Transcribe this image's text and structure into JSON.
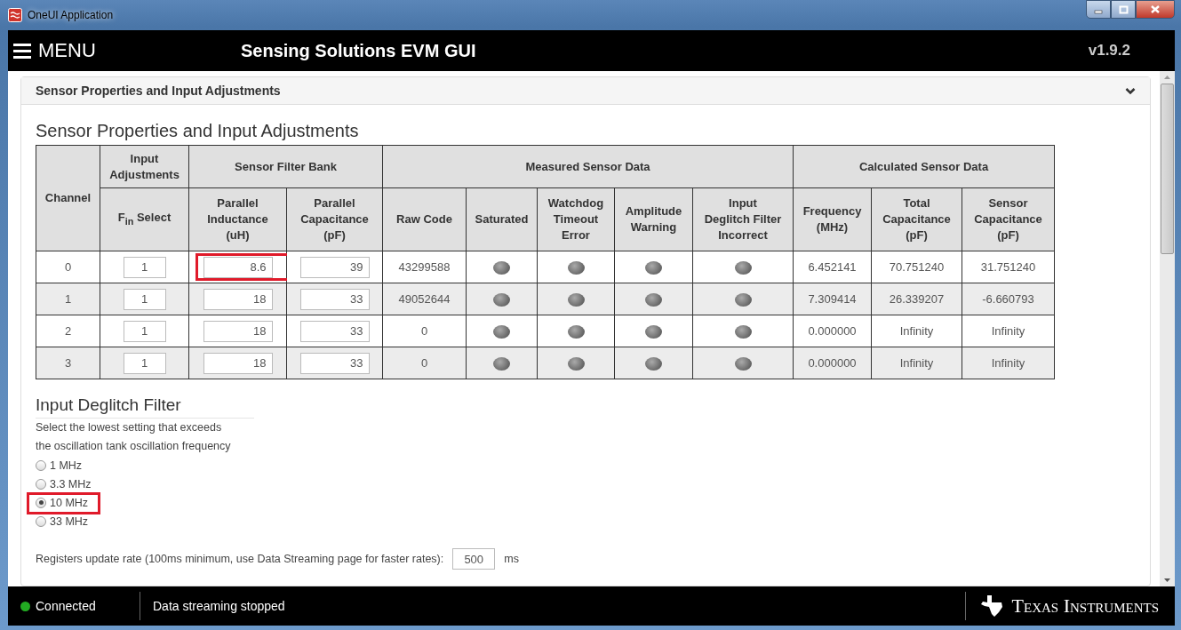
{
  "window": {
    "title": "OneUI Application"
  },
  "header": {
    "menu_label": "MENU",
    "title": "Sensing Solutions EVM GUI",
    "version": "v1.9.2"
  },
  "accordion": {
    "title": "Sensor Properties and Input Adjustments",
    "expanded": true
  },
  "section_title": "Sensor Properties and Input Adjustments",
  "table": {
    "groups": [
      {
        "label": "Channel"
      },
      {
        "label": "Input\nAdjustments",
        "columns": [
          "F$_{in}$ Select"
        ]
      },
      {
        "label": "Sensor Filter Bank",
        "columns": [
          "Parallel\nInductance\n(uH)",
          "Parallel\nCapacitance\n(pF)"
        ]
      },
      {
        "label": "Measured Sensor Data",
        "columns": [
          "Raw Code",
          "Saturated",
          "Watchdog\nTimeout\nError",
          "Amplitude\nWarning",
          "Input\nDeglitch Filter\nIncorrect"
        ]
      },
      {
        "label": "Calculated Sensor Data",
        "columns": [
          "Frequency\n(MHz)",
          "Total\nCapacitance\n(pF)",
          "Sensor\nCapacitance\n(pF)"
        ]
      }
    ],
    "rows": [
      {
        "channel": "0",
        "fin": "1",
        "inductance": "8.6",
        "capacitance": "39",
        "highlighted": true,
        "raw_code": "43299588",
        "saturated": false,
        "watchdog": false,
        "amplitude": false,
        "deglitch": false,
        "frequency": "6.452141",
        "total_capacitance": "70.751240",
        "sensor_capacitance": "31.751240"
      },
      {
        "channel": "1",
        "fin": "1",
        "inductance": "18",
        "capacitance": "33",
        "highlighted": false,
        "raw_code": "49052644",
        "saturated": false,
        "watchdog": false,
        "amplitude": false,
        "deglitch": false,
        "frequency": "7.309414",
        "total_capacitance": "26.339207",
        "sensor_capacitance": "-6.660793"
      },
      {
        "channel": "2",
        "fin": "1",
        "inductance": "18",
        "capacitance": "33",
        "highlighted": false,
        "raw_code": "0",
        "saturated": false,
        "watchdog": false,
        "amplitude": false,
        "deglitch": false,
        "frequency": "0.000000",
        "total_capacitance": "Infinity",
        "sensor_capacitance": "Infinity"
      },
      {
        "channel": "3",
        "fin": "1",
        "inductance": "18",
        "capacitance": "33",
        "highlighted": false,
        "raw_code": "0",
        "saturated": false,
        "watchdog": false,
        "amplitude": false,
        "deglitch": false,
        "frequency": "0.000000",
        "total_capacitance": "Infinity",
        "sensor_capacitance": "Infinity"
      }
    ]
  },
  "deglitch": {
    "title": "Input Deglitch Filter",
    "description_lines": [
      "Select the lowest setting that exceeds",
      "the oscillation tank oscillation frequency"
    ],
    "options": [
      {
        "label": "1 MHz",
        "selected": false,
        "highlighted": false
      },
      {
        "label": "3.3 MHz",
        "selected": false,
        "highlighted": false
      },
      {
        "label": "10 MHz",
        "selected": true,
        "highlighted": true
      },
      {
        "label": "33 MHz",
        "selected": false,
        "highlighted": false
      }
    ]
  },
  "update_rate": {
    "label": "Registers update rate (100ms minimum, use Data Streaming page for faster rates):",
    "value": "500",
    "unit": "ms"
  },
  "status_bar": {
    "connection": {
      "label": "Connected",
      "color": "#22aa22"
    },
    "message": "Data streaming stopped",
    "brand": "Texas Instruments"
  }
}
